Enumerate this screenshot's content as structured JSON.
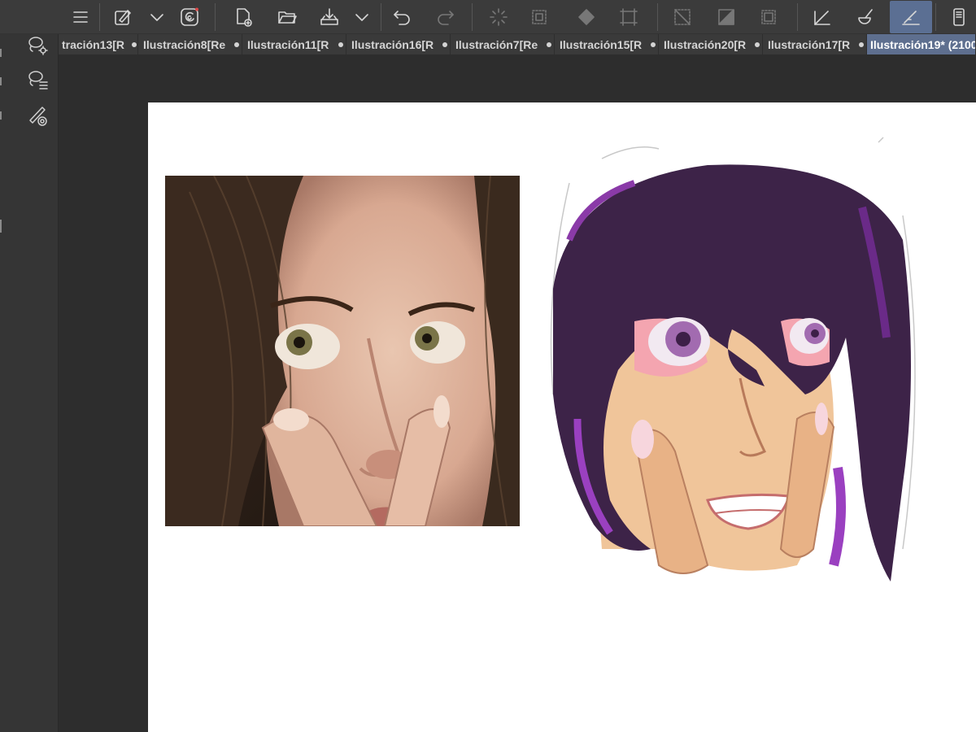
{
  "toolbar": {
    "expand_glyph": ">",
    "collapse_glyph": "«",
    "right_glyph": ">"
  },
  "tabs": [
    {
      "label": "tración13[R",
      "modified": true,
      "active": false
    },
    {
      "label": "Ilustración8[Re",
      "modified": true,
      "active": false
    },
    {
      "label": "Ilustración11[R",
      "modified": true,
      "active": false
    },
    {
      "label": "Ilustración16[R",
      "modified": true,
      "active": false
    },
    {
      "label": "Ilustración7[Re",
      "modified": true,
      "active": false
    },
    {
      "label": "Ilustración15[R",
      "modified": true,
      "active": false
    },
    {
      "label": "Ilustración20[R",
      "modified": true,
      "active": false
    },
    {
      "label": "Ilustración17[R",
      "modified": true,
      "active": false
    },
    {
      "label": "Ilustración19* (2100",
      "modified": false,
      "active": true
    }
  ],
  "colors": {
    "accent": "#5b6f93",
    "canvas": "#ffffff",
    "hair": "#3d2348",
    "skin": "#f1c79b"
  }
}
